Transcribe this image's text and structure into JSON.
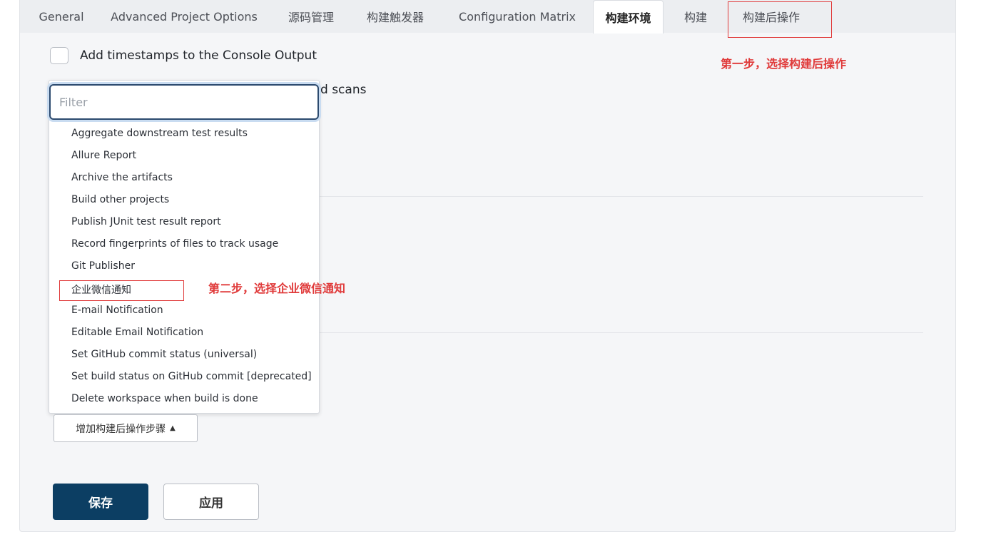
{
  "tabs": [
    {
      "label": "General"
    },
    {
      "label": "Advanced Project Options"
    },
    {
      "label": "源码管理"
    },
    {
      "label": "构建触发器"
    },
    {
      "label": "Configuration Matrix"
    },
    {
      "label": "构建环境",
      "active": true
    },
    {
      "label": "构建"
    },
    {
      "label": "构建后操作"
    }
  ],
  "annotations": {
    "step1": "第一步，选择构建后操作",
    "step2": "第二步，选择企业微信通知"
  },
  "options": {
    "timestamps_label": "Add timestamps to the Console Output",
    "hidden_label_fragment": "d scans"
  },
  "dropdown": {
    "filter_placeholder": "Filter",
    "items": [
      "Aggregate downstream test results",
      "Allure Report",
      "Archive the artifacts",
      "Build other projects",
      "Publish JUnit test result report",
      "Record fingerprints of files to track usage",
      "Git Publisher",
      "企业微信通知",
      "E-mail Notification",
      "Editable Email Notification",
      "Set GitHub commit status (universal)",
      "Set build status on GitHub commit [deprecated]",
      "Delete workspace when build is done"
    ]
  },
  "buttons": {
    "add_step": "增加构建后操作步骤",
    "add_step_caret": "▲",
    "save": "保存",
    "apply": "应用"
  },
  "colors": {
    "annotation_red": "#e03a3a",
    "primary_button": "#0c3e63",
    "filter_focus": "#2c4a6e"
  }
}
